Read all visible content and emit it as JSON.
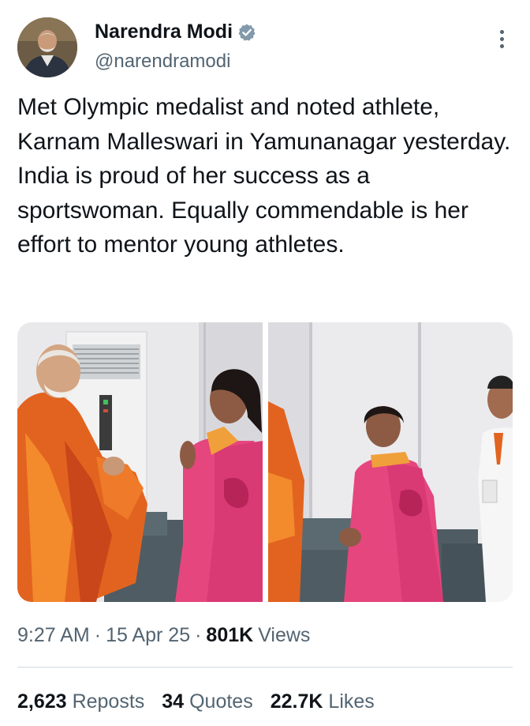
{
  "author": {
    "name": "Narendra Modi",
    "handle": "@narendramodi",
    "verified_icon": "verified-badge-icon",
    "verified_color": "#829aab"
  },
  "tweet": {
    "text": "Met Olympic medalist and noted athlete, Karnam Malleswari in Yamunanagar yesterday. India is proud of her success as a sportswoman. Equally commendable is her effort to mentor young athletes."
  },
  "media": {
    "count": 2
  },
  "meta": {
    "time": "9:27 AM",
    "separator": "·",
    "date": "15 Apr 25",
    "views_count": "801K",
    "views_label": "Views"
  },
  "stats": {
    "reposts_count": "2,623",
    "reposts_label": "Reposts",
    "quotes_count": "34",
    "quotes_label": "Quotes",
    "likes_count": "22.7K",
    "likes_label": "Likes"
  },
  "colors": {
    "text_primary": "#0f1419",
    "text_secondary": "#536471",
    "divider": "#cfd9de"
  }
}
